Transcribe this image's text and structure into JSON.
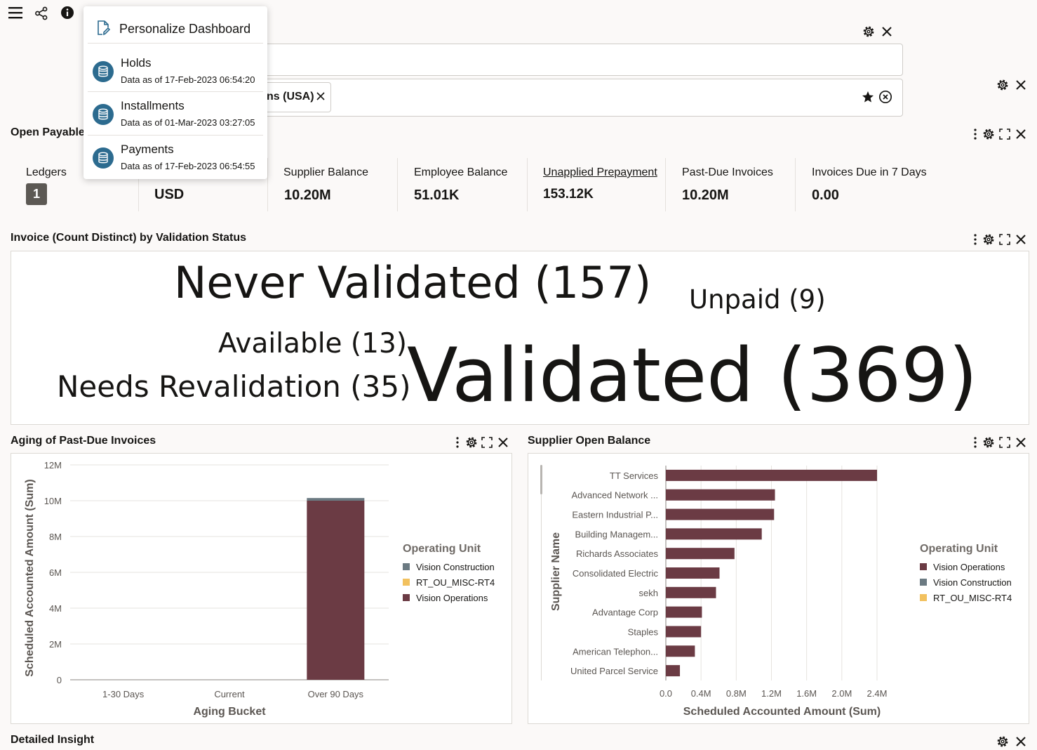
{
  "toolbar": {
    "menu_icon": "hamburger-icon",
    "share_icon": "share-icon",
    "info_icon": "info-icon"
  },
  "filters": {
    "chip_label": "ns (USA)"
  },
  "open_payables": {
    "title": "Open Payables",
    "kpis": [
      {
        "label": "Ledgers",
        "value": "1"
      },
      {
        "label": "",
        "value": "USD"
      },
      {
        "label": "Supplier Balance",
        "value": "10.20M"
      },
      {
        "label": "Employee Balance",
        "value": "51.01K"
      },
      {
        "label": "Unapplied Prepayment",
        "value": "153.12K"
      },
      {
        "label": "Past-Due Invoices",
        "value": "10.20M"
      },
      {
        "label": "Invoices Due in 7 Days",
        "value": "0.00"
      }
    ]
  },
  "validation": {
    "title": "Invoice (Count Distinct) by Validation Status",
    "tags": [
      {
        "text": "Never Validated (157)"
      },
      {
        "text": "Unpaid (9)"
      },
      {
        "text": "Available (13)"
      },
      {
        "text": "Needs Revalidation (35)"
      },
      {
        "text": "Validated (369)"
      }
    ]
  },
  "aging": {
    "title": "Aging of Past-Due Invoices"
  },
  "supplier": {
    "title": "Supplier Open Balance"
  },
  "detailed": {
    "title": "Detailed Insight"
  },
  "popup": {
    "header": "Personalize Dashboard",
    "items": [
      {
        "name": "Holds",
        "sub": "Data as of 17-Feb-2023 06:54:20"
      },
      {
        "name": "Installments",
        "sub": "Data as of 01-Mar-2023 03:27:05"
      },
      {
        "name": "Payments",
        "sub": "Data as of 17-Feb-2023 06:54:55"
      }
    ]
  },
  "colors": {
    "vision_operations": "#6b3b44",
    "vision_construction": "#6b7a82",
    "rt_ou_misc": "#f2c15f"
  },
  "chart_data": [
    {
      "type": "bar",
      "stacked": true,
      "categories": [
        "1-30 Days",
        "Current",
        "Over 90 Days"
      ],
      "series": [
        {
          "name": "Vision Construction",
          "values": [
            0,
            0,
            0.15
          ]
        },
        {
          "name": "RT_OU_MISC-RT4",
          "values": [
            0,
            0,
            0
          ]
        },
        {
          "name": "Vision Operations",
          "values": [
            0,
            0,
            10.0
          ]
        }
      ],
      "ytick_labels": [
        "0",
        "2M",
        "4M",
        "6M",
        "8M",
        "10M",
        "12M"
      ],
      "xlabel": "Aging Bucket",
      "ylabel": "Scheduled Accounted Amount (Sum)",
      "ylim": [
        0,
        12
      ],
      "legend_title": "Operating Unit",
      "legend_position": "right",
      "grid": true
    },
    {
      "type": "bar",
      "orientation": "horizontal",
      "categories": [
        "TT Services",
        "Advanced Network ...",
        "Eastern Industrial P...",
        "Building Managem...",
        "Richards Associates",
        "Consolidated Electric",
        "sekh",
        "Advantage Corp",
        "Staples",
        "American Telephon...",
        "United Parcel Service"
      ],
      "series": [
        {
          "name": "Vision Operations",
          "values": [
            2.4,
            1.24,
            1.23,
            1.09,
            0.78,
            0.61,
            0.57,
            0.41,
            0.4,
            0.33,
            0.16
          ]
        },
        {
          "name": "Vision Construction",
          "values": [
            0,
            0,
            0,
            0,
            0,
            0,
            0,
            0,
            0,
            0,
            0
          ]
        },
        {
          "name": "RT_OU_MISC-RT4",
          "values": [
            0,
            0,
            0,
            0,
            0,
            0,
            0,
            0,
            0,
            0,
            0
          ]
        }
      ],
      "xtick_labels": [
        "0.0",
        "0.4M",
        "0.8M",
        "1.2M",
        "1.6M",
        "2.0M",
        "2.4M"
      ],
      "xlabel": "Scheduled Accounted Amount (Sum)",
      "ylabel": "Supplier Name",
      "xlim": [
        0,
        2.4
      ],
      "legend_title": "Operating Unit",
      "legend_position": "right",
      "grid": true
    }
  ]
}
